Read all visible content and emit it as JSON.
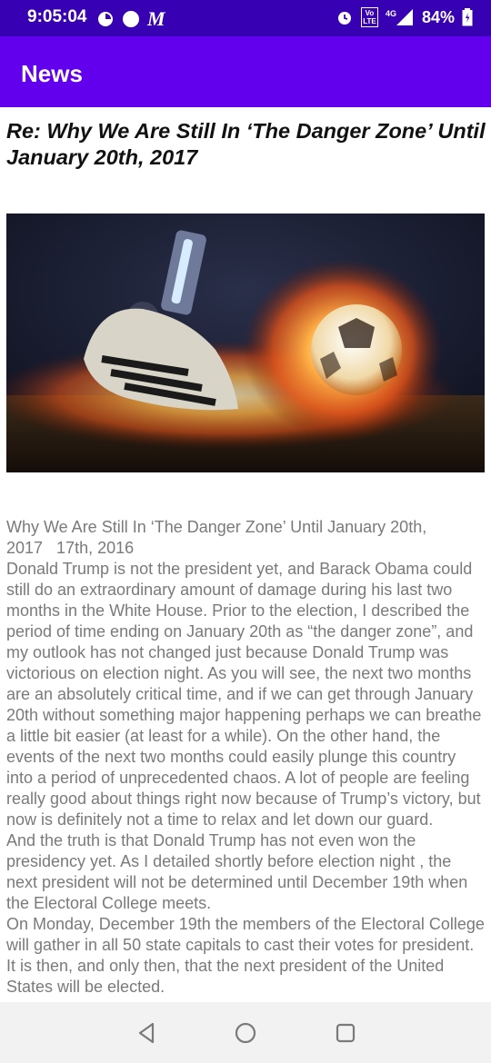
{
  "status_bar": {
    "time": "9:05:04",
    "carrier_logo": "M",
    "battery": "84%",
    "net_label": "4G",
    "volte_label": "Vo LTE",
    "icons": [
      "pie-chart-icon",
      "circle-icon",
      "alarm-icon",
      "volte-icon",
      "signal-icon",
      "battery-icon"
    ]
  },
  "app_bar": {
    "title": "News"
  },
  "article": {
    "title": "Re: Why We Are Still In ‘The Danger Zone’ Until January 20th, 2017",
    "image_alt": "soccer cleat kicking a flaming ball",
    "paragraphs": [
      "Why We Are Still In ‘The Danger Zone’ Until January 20th, 2017   17th, 2016",
      "Donald Trump is not the president yet, and Barack Obama could still do an extraordinary amount of damage during his last two months in the White House. Prior to the election, I described the period of time ending on January 20th as “the danger zone”, and my outlook has not changed just because Donald Trump was victorious on election night. As you will see, the next two months are an absolutely critical time, and if we can get through January 20th without something major happening perhaps we can breathe a little bit easier (at least for a while). On the other hand, the events of the next two months could easily plunge this country into a period of unprecedented chaos. A lot of people are feeling really good about things right now because of Trump’s victory, but now is definitely not a time to relax and let down our guard.",
      "And the truth is that Donald Trump has not even won the presidency yet. As I detailed shortly before election night , the next president will not be determined until December 19th when the Electoral College meets.",
      "On Monday, December 19th the members of the Electoral College will gather in all 50 state capitals to cast their votes for president. It is then, and only then, that the next president of the United States will be elected."
    ]
  },
  "nav_bar": {
    "buttons": [
      "back-icon",
      "home-icon",
      "recents-icon"
    ]
  }
}
